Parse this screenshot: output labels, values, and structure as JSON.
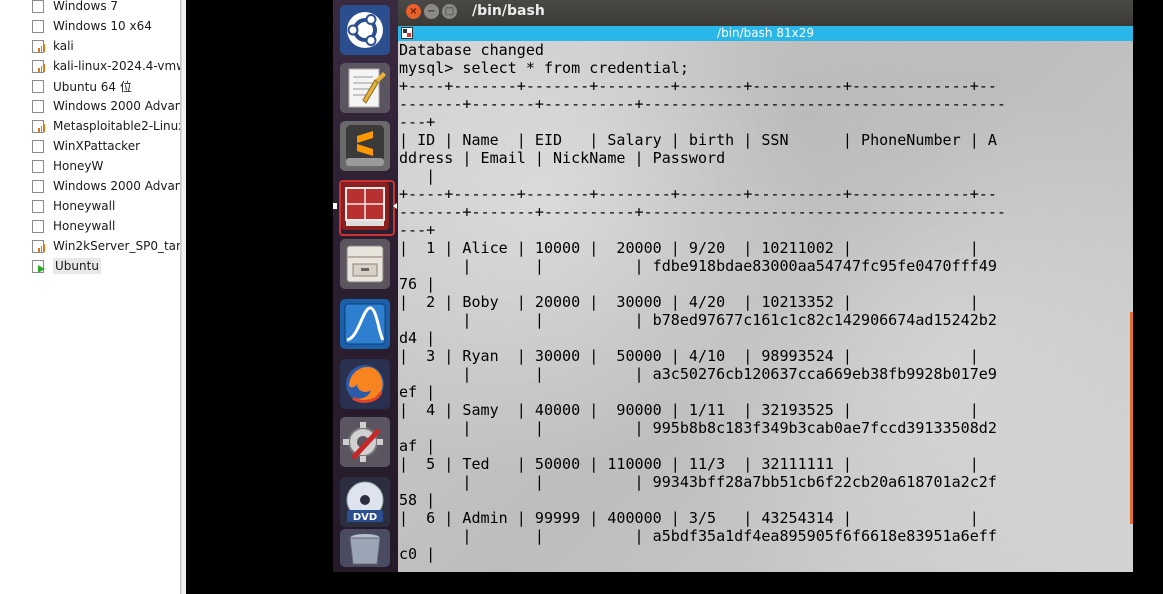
{
  "library": {
    "items": [
      {
        "label": "Windows 7",
        "state": "off"
      },
      {
        "label": "Windows 10 x64",
        "state": "off"
      },
      {
        "label": "kali",
        "state": "suspended"
      },
      {
        "label": "kali-linux-2024.4-vmw",
        "state": "suspended"
      },
      {
        "label": "Ubuntu 64 位",
        "state": "off"
      },
      {
        "label": "Windows 2000 Advan",
        "state": "off"
      },
      {
        "label": "Metasploitable2-Linux",
        "state": "suspended"
      },
      {
        "label": "WinXPattacker",
        "state": "off"
      },
      {
        "label": "HoneyW",
        "state": "off"
      },
      {
        "label": "Windows 2000 Advan",
        "state": "off"
      },
      {
        "label": "Honeywall",
        "state": "off"
      },
      {
        "label": "Honeywall",
        "state": "off"
      },
      {
        "label": "Win2kServer_SP0_targ",
        "state": "suspended"
      },
      {
        "label": "Ubuntu",
        "state": "running"
      }
    ]
  },
  "launcher": {
    "icons": [
      "ubuntu-logo-icon",
      "text-editor-icon",
      "sublime-text-icon",
      "terminal-icon",
      "file-manager-icon",
      "wireshark-icon",
      "firefox-icon",
      "system-settings-icon",
      "dvd-icon",
      "trash-icon"
    ]
  },
  "window": {
    "title": "/bin/bash",
    "tab_title": "/bin/bash 81x29",
    "close_glyph": "×",
    "min_glyph": "−",
    "max_glyph": "□"
  },
  "terminal": {
    "lines": [
      "Database changed",
      "mysql> select * from credential;",
      "+----+-------+-------+--------+-------+----------+-------------+--",
      "-------+-------+----------+----------------------------------------",
      "---+",
      "| ID | Name  | EID   | Salary | birth | SSN      | PhoneNumber | A",
      "ddress | Email | NickName | Password",
      "   |",
      "+----+-------+-------+--------+-------+----------+-------------+--",
      "-------+-------+----------+----------------------------------------",
      "---+",
      "|  1 | Alice | 10000 |  20000 | 9/20  | 10211002 |             |",
      "       |       |          | fdbe918bdae83000aa54747fc95fe0470fff49",
      "76 |",
      "|  2 | Boby  | 20000 |  30000 | 4/20  | 10213352 |             |",
      "       |       |          | b78ed97677c161c1c82c142906674ad15242b2",
      "d4 |",
      "|  3 | Ryan  | 30000 |  50000 | 4/10  | 98993524 |             |",
      "       |       |          | a3c50276cb120637cca669eb38fb9928b017e9",
      "ef |",
      "|  4 | Samy  | 40000 |  90000 | 1/11  | 32193525 |             |",
      "       |       |          | 995b8b8c183f349b3cab0ae7fccd39133508d2",
      "af |",
      "|  5 | Ted   | 50000 | 110000 | 11/3  | 32111111 |             |",
      "       |       |          | 99343bff28a7bb51cb6f22cb20a618701a2c2f",
      "58 |",
      "|  6 | Admin | 99999 | 400000 | 3/5   | 43254314 |             |",
      "       |       |          | a5bdf35a1df4ea895905f6f6618e83951a6eff",
      "c0 |"
    ]
  }
}
